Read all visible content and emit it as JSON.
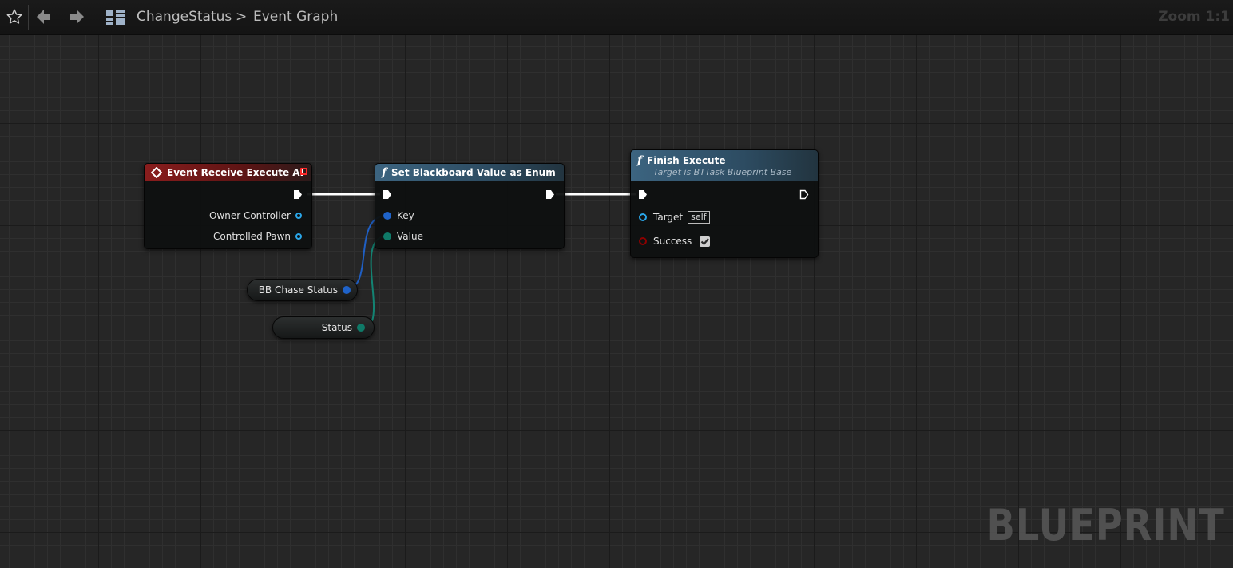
{
  "toolbar": {
    "favorite_icon": "star-icon",
    "back_icon": "arrow-left-icon",
    "forward_icon": "arrow-right-icon",
    "graph_icon": "blueprint-graph-icon",
    "breadcrumb_blueprint": "ChangeStatus",
    "breadcrumb_separator": ">",
    "breadcrumb_graph": "Event Graph",
    "zoom_label": "Zoom 1:1"
  },
  "watermark": "BLUEPRINT",
  "nodes": {
    "event_receive_execute_ai": {
      "title": "Event Receive Execute AI",
      "pins": {
        "owner_controller": "Owner Controller",
        "controlled_pawn": "Controlled Pawn"
      }
    },
    "set_blackboard_value_as_enum": {
      "icon": "f",
      "title": "Set Blackboard Value as Enum",
      "pins": {
        "key": "Key",
        "value": "Value"
      }
    },
    "finish_execute": {
      "icon": "f",
      "title": "Finish Execute",
      "subtitle": "Target is BTTask Blueprint Base",
      "pins": {
        "target": "Target",
        "target_default": "self",
        "success": "Success"
      },
      "success_checked": true
    },
    "bb_chase_status": {
      "label": "BB Chase Status"
    },
    "status": {
      "label": "Status"
    }
  },
  "colors": {
    "event_header": "#8a1d1d",
    "function_header": "#3c6480",
    "object_pin": "#2aa6e8",
    "struct_pin": "#1f63c9",
    "enum_pin": "#0f7a68",
    "bool_pin": "#8c0000",
    "exec_wire": "#ffffff"
  }
}
